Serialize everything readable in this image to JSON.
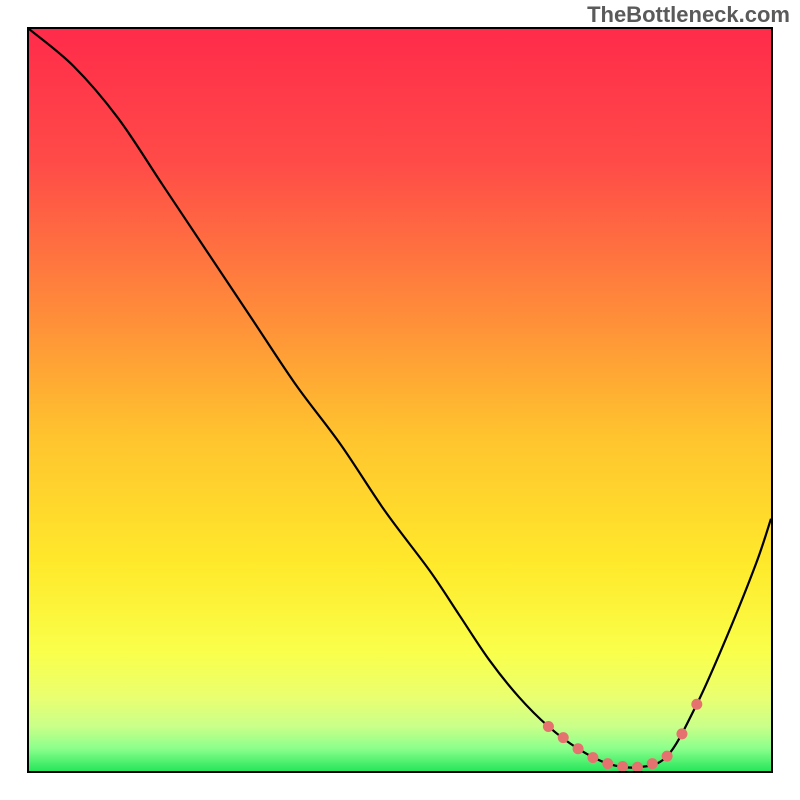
{
  "watermark": "TheBottleneck.com",
  "chart_data": {
    "type": "line",
    "title": "",
    "xlabel": "",
    "ylabel": "",
    "xlim": [
      0,
      100
    ],
    "ylim": [
      0,
      100
    ],
    "gradient_stops": [
      {
        "offset": 0,
        "color": "#ff2b4a"
      },
      {
        "offset": 18,
        "color": "#ff4b48"
      },
      {
        "offset": 38,
        "color": "#ff8b3a"
      },
      {
        "offset": 55,
        "color": "#ffc42e"
      },
      {
        "offset": 72,
        "color": "#ffe92b"
      },
      {
        "offset": 84,
        "color": "#f9ff4a"
      },
      {
        "offset": 90,
        "color": "#eaff70"
      },
      {
        "offset": 94,
        "color": "#c9ff8a"
      },
      {
        "offset": 97,
        "color": "#8bff8b"
      },
      {
        "offset": 100,
        "color": "#27e65b"
      }
    ],
    "series": [
      {
        "name": "bottleneck-curve",
        "color": "#000000",
        "x": [
          0,
          6,
          12,
          18,
          24,
          30,
          36,
          42,
          48,
          54,
          58,
          62,
          66,
          70,
          74,
          78,
          82,
          86,
          90,
          94,
          98,
          100
        ],
        "y": [
          100,
          95,
          88,
          79,
          70,
          61,
          52,
          44,
          35,
          27,
          21,
          15,
          10,
          6,
          3,
          1,
          0.5,
          2,
          9,
          18,
          28,
          34
        ]
      }
    ],
    "markers": {
      "name": "valley-markers",
      "color": "#e5726e",
      "radius": 5.5,
      "points": [
        {
          "x": 70,
          "y": 6
        },
        {
          "x": 72,
          "y": 4.5
        },
        {
          "x": 74,
          "y": 3
        },
        {
          "x": 76,
          "y": 1.8
        },
        {
          "x": 78,
          "y": 1
        },
        {
          "x": 80,
          "y": 0.6
        },
        {
          "x": 82,
          "y": 0.5
        },
        {
          "x": 84,
          "y": 1
        },
        {
          "x": 86,
          "y": 2
        },
        {
          "x": 88,
          "y": 5
        },
        {
          "x": 90,
          "y": 9
        }
      ]
    }
  }
}
